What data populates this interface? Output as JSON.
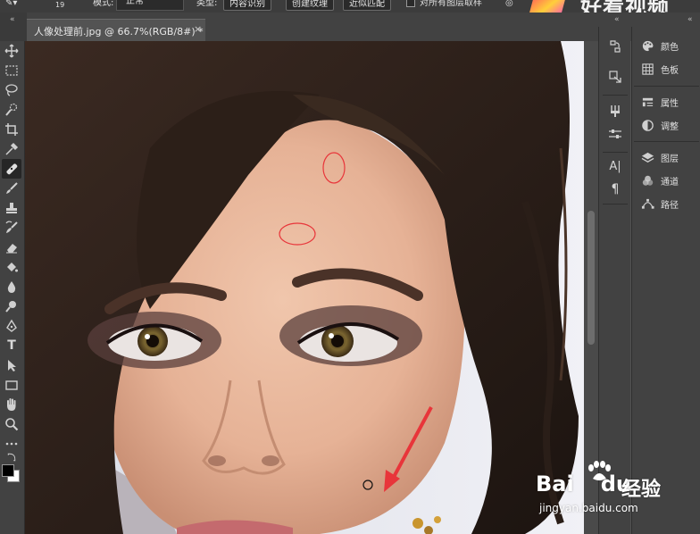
{
  "options_bar": {
    "size_value": "19",
    "mode_label": "模式:",
    "mode_value": "正常",
    "type_label": "类型:",
    "type_buttons": [
      "内容识别",
      "创建纹理",
      "近似匹配"
    ],
    "sample_all_layers_label": "对所有图层取样",
    "brand": "好看视频"
  },
  "document_tab": {
    "title": "人像处理前.jpg @ 66.7%(RGB/8#) *",
    "close": "×"
  },
  "collapse_glyph": "«",
  "toolbar": {
    "tools": [
      "move-tool",
      "marquee-tool",
      "lasso-tool",
      "quick-select-tool",
      "crop-tool",
      "eyedropper-tool",
      "spot-healing-brush-tool",
      "brush-tool",
      "clone-stamp-tool",
      "history-brush-tool",
      "eraser-tool",
      "paint-bucket-tool",
      "blur-tool",
      "dodge-tool",
      "pen-tool",
      "type-tool",
      "path-selection-tool",
      "rectangle-tool",
      "hand-tool",
      "zoom-tool",
      "more-tools"
    ],
    "type_tool_glyph": "T",
    "foreground_color": "#000000",
    "background_color": "#ffffff"
  },
  "icon_panel": {
    "items": [
      "history-icon",
      "actions-icon",
      "brushes-icon",
      "adjust-sliders-icon",
      "character-icon",
      "paragraph-icon"
    ],
    "character_glyph": "A|",
    "paragraph_glyph": "¶"
  },
  "panels": {
    "groups": [
      {
        "items": [
          {
            "icon": "palette-icon",
            "label": "颜色"
          },
          {
            "icon": "swatches-icon",
            "label": "色板"
          }
        ]
      },
      {
        "items": [
          {
            "icon": "properties-icon",
            "label": "属性"
          },
          {
            "icon": "adjustments-icon",
            "label": "调整"
          }
        ]
      },
      {
        "items": [
          {
            "icon": "layers-icon",
            "label": "图层"
          },
          {
            "icon": "channels-icon",
            "label": "通道"
          },
          {
            "icon": "paths-icon",
            "label": "路径"
          }
        ]
      }
    ]
  },
  "watermark": {
    "bai": "Bai",
    "du": "du",
    "jingyan": "经验",
    "url": "jingyan.baidu.com"
  },
  "colors": {
    "annotation_red": "#e8353a",
    "ui_dark": "#424242",
    "canvas_bg": "#535353"
  }
}
